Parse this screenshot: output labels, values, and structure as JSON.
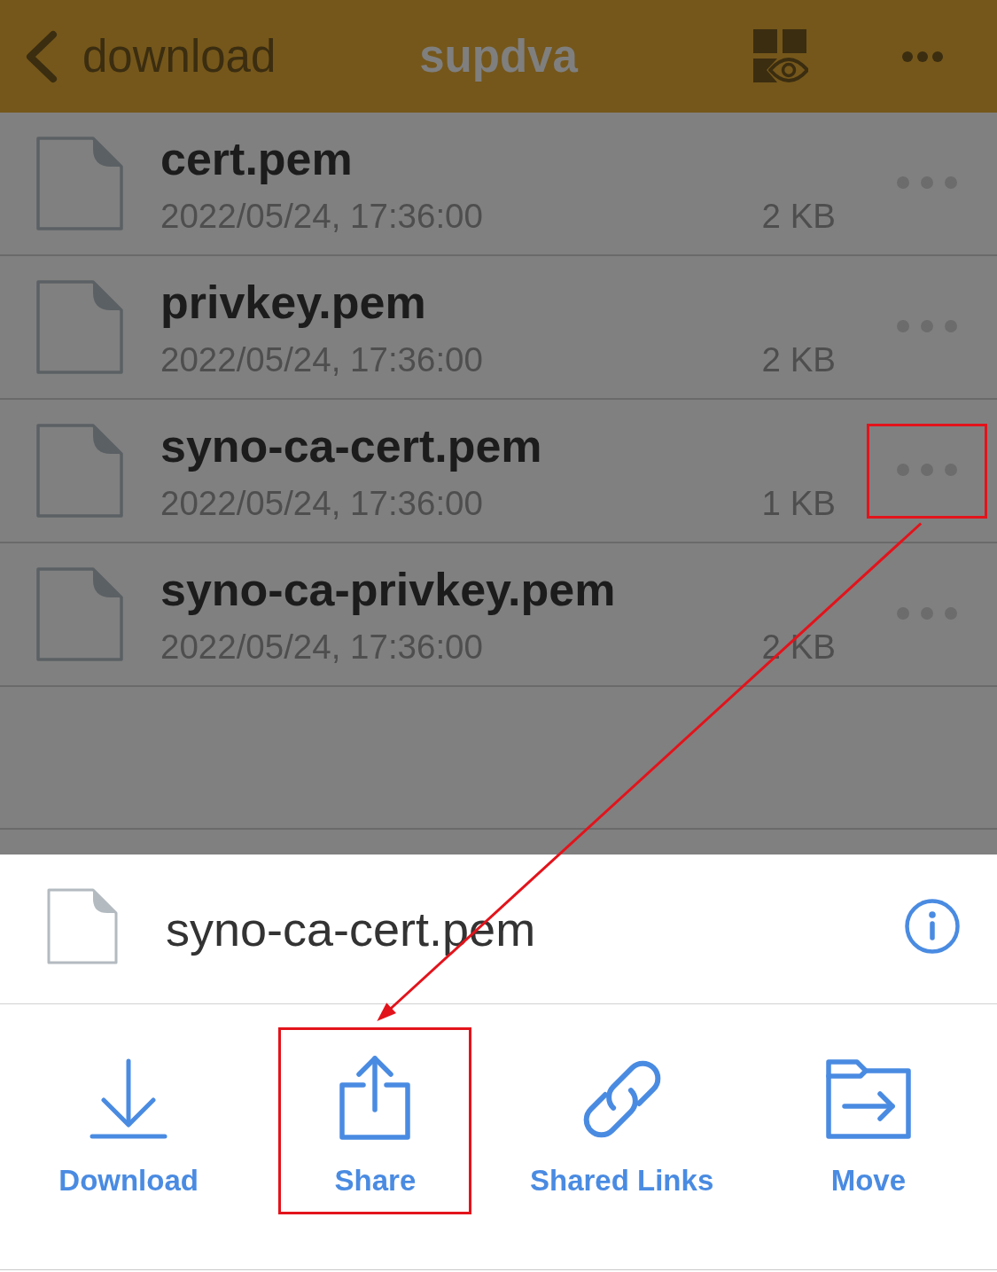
{
  "header": {
    "back_label": "download",
    "title": "supdva"
  },
  "files": [
    {
      "name": "cert.pem",
      "modified": "2022/05/24, 17:36:00",
      "size": "2 KB",
      "highlighted": false
    },
    {
      "name": "privkey.pem",
      "modified": "2022/05/24, 17:36:00",
      "size": "2 KB",
      "highlighted": false
    },
    {
      "name": "syno-ca-cert.pem",
      "modified": "2022/05/24, 17:36:00",
      "size": "1 KB",
      "highlighted": true
    },
    {
      "name": "syno-ca-privkey.pem",
      "modified": "2022/05/24, 17:36:00",
      "size": "2 KB",
      "highlighted": false
    }
  ],
  "action_sheet": {
    "file_name": "syno-ca-cert.pem",
    "actions": [
      {
        "kind": "download",
        "label": "Download",
        "highlighted": false
      },
      {
        "kind": "share",
        "label": "Share",
        "highlighted": true
      },
      {
        "kind": "link",
        "label": "Shared Links",
        "highlighted": false
      },
      {
        "kind": "move",
        "label": "Move",
        "highlighted": false
      }
    ]
  }
}
